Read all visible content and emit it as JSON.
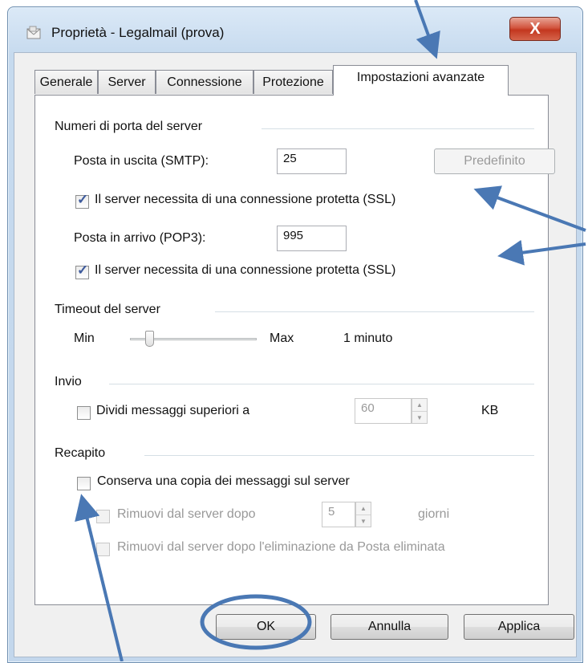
{
  "window": {
    "title": "Proprietà - Legalmail (prova)",
    "close_glyph": "X"
  },
  "tabs": [
    {
      "label": "Generale",
      "active": false
    },
    {
      "label": "Server",
      "active": false
    },
    {
      "label": "Connessione",
      "active": false
    },
    {
      "label": "Protezione",
      "active": false
    },
    {
      "label": "Impostazioni avanzate",
      "active": true
    }
  ],
  "ports": {
    "group_label": "Numeri di porta del server",
    "smtp_label": "Posta in uscita (SMTP):",
    "smtp_value": "25",
    "default_button": "Predefinito",
    "smtp_ssl_label": "Il server necessita di una connessione protetta (SSL)",
    "smtp_ssl_checked": true,
    "pop3_label": "Posta in arrivo (POP3):",
    "pop3_value": "995",
    "pop3_ssl_label": "Il server necessita di una connessione protetta (SSL)",
    "pop3_ssl_checked": true
  },
  "timeout": {
    "group_label": "Timeout del server",
    "min_label": "Min",
    "max_label": "Max",
    "value_text": "1 minuto",
    "slider_level": 0.13
  },
  "sending": {
    "group_label": "Invio",
    "split_label": "Dividi messaggi superiori a",
    "split_checked": false,
    "split_value": "60",
    "unit": "KB"
  },
  "delivery": {
    "group_label": "Recapito",
    "keep_copy_label": "Conserva una copia dei messaggi sul server",
    "keep_copy_checked": false,
    "remove_after_label": "Rimuovi dal server dopo",
    "remove_after_value": "5",
    "remove_after_unit": "giorni",
    "remove_deleted_label": "Rimuovi dal server dopo l'eliminazione da Posta eliminata"
  },
  "buttons": {
    "ok": "OK",
    "cancel": "Annulla",
    "apply": "Applica"
  },
  "colors": {
    "annotation_blue": "#4a78b4",
    "close_red": "#c3371f"
  },
  "icons": {
    "app": "mail-account-icon",
    "spinner_up": "spin-up-icon",
    "spinner_down": "spin-down-icon"
  }
}
